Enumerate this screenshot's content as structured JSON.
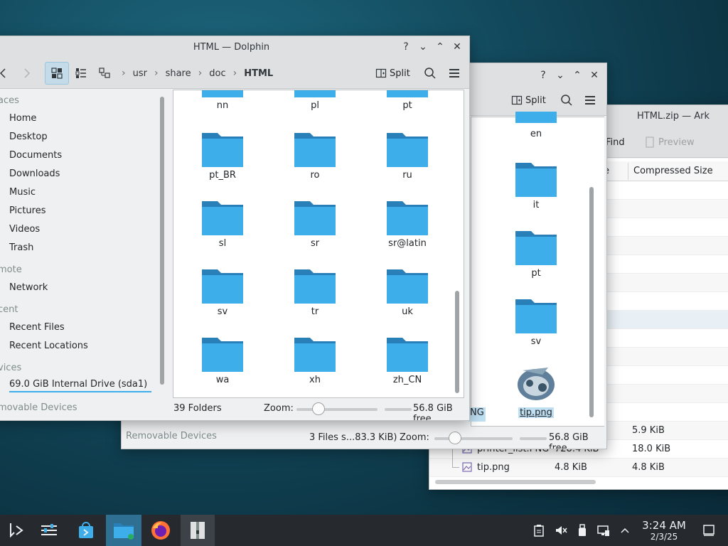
{
  "dolphin": {
    "title": "HTML — Dolphin",
    "split_label": "Split",
    "breadcrumbs": [
      "usr",
      "share",
      "doc",
      "HTML"
    ],
    "places": {
      "places_header": "aces",
      "items": [
        "Home",
        "Desktop",
        "Documents",
        "Downloads",
        "Music",
        "Pictures",
        "Videos",
        "Trash"
      ],
      "remote_header": "mote",
      "remote_items": [
        "Network"
      ],
      "recent_header": "cent",
      "recent_items": [
        "Recent Files",
        "Recent Locations"
      ],
      "devices_header": "vices",
      "devices_items": [
        "69.0 GiB Internal Drive (sda1)"
      ],
      "removable_header": "movable Devices"
    },
    "folders": [
      "nn",
      "pl",
      "pt",
      "pt_BR",
      "ro",
      "ru",
      "sl",
      "sr",
      "sr@latin",
      "sv",
      "tr",
      "uk",
      "wa",
      "xh",
      "zh_CN"
    ],
    "status": {
      "count": "39 Folders",
      "zoom_label": "Zoom:",
      "free": "56.8 GiB free"
    }
  },
  "dolphin2": {
    "split_label": "Split",
    "folders": [
      "en",
      "it",
      "pt",
      "sv"
    ],
    "file": "tip.png",
    "partial_file": "NG",
    "removable_label": "Removable Devices",
    "status": {
      "count": "3 Files s...83.3 KiB)",
      "zoom_label": "Zoom:",
      "free": "56.8 GiB free"
    }
  },
  "ark": {
    "title": "HTML.zip — Ark",
    "find_label": "Find",
    "preview_label": "Preview",
    "col_partial": "e",
    "col_compressed": "Compressed Size",
    "rows": [
      {
        "name": "",
        "size": "",
        "compressed": "5.9 KiB"
      },
      {
        "name": "printer_list.PNG",
        "size": "728.4 KiB",
        "compressed": "18.0 KiB"
      },
      {
        "name": "tip.png",
        "size": "4.8 KiB",
        "compressed": "4.8 KiB"
      }
    ]
  },
  "taskbar": {
    "time": "3:24 AM",
    "date": "2/3/25"
  },
  "colors": {
    "folder": "#3daee9",
    "folder_tab": "#2980b9",
    "accent": "#3daee9"
  }
}
